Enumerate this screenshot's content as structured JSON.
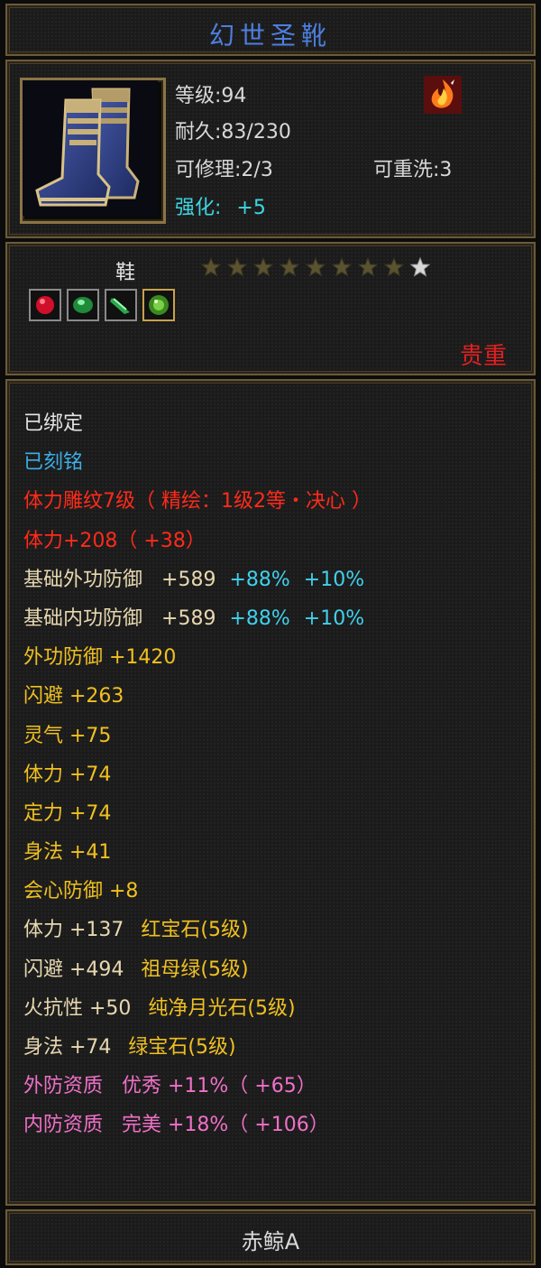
{
  "title": "幻世圣靴",
  "header": {
    "level": "等级:94",
    "durability": "耐久:83/230",
    "repairable": "可修理:2/3",
    "rewashable": "可重洗:3",
    "refine_label": "强化:",
    "refine_value": "+5"
  },
  "equip": {
    "type": "鞋",
    "stars_filled": 8,
    "stars_total": 9,
    "rarity": "贵重"
  },
  "attributes": {
    "bound": "已绑定",
    "engraved": "已刻铭",
    "carving": "体力雕纹7级（ 精绘：1级2等・决心 ）",
    "stamina_bonus": "体力+208（ +38）",
    "base_ext_def": {
      "label": "基础外功防御",
      "value": "+589",
      "pct1": "+88%",
      "pct2": "+10%"
    },
    "base_int_def": {
      "label": "基础内功防御",
      "value": "+589",
      "pct1": "+88%",
      "pct2": "+10%"
    },
    "ext_def": "外功防御 +1420",
    "dodge": "闪避 +263",
    "spirit": "灵气 +75",
    "stamina": "体力 +74",
    "focus": "定力 +74",
    "agility": "身法 +41",
    "crit_def": "会心防御 +8",
    "gem1": {
      "stat": "体力 +137",
      "gem": "红宝石(5级)"
    },
    "gem2": {
      "stat": "闪避 +494",
      "gem": "祖母绿(5级)"
    },
    "gem3": {
      "stat": "火抗性 +50",
      "gem": "纯净月光石(5级)"
    },
    "gem4": {
      "stat": "身法 +74",
      "gem": "绿宝石(5级)"
    },
    "ext_quality": "外防资质   优秀 +11%（ +65）",
    "int_quality": "内防资质   完美 +18%（ +106）"
  },
  "footer": {
    "owner": "赤鲸A"
  },
  "colors": {
    "title": "#4d7fe0",
    "refine": "#3ed6e0",
    "rarity": "#e02020",
    "gold_attr": "#f0c020",
    "pink_attr": "#f070c8"
  },
  "icons": [
    "boots-icon",
    "fire-skill-icon",
    "star-icon",
    "red-gem-icon",
    "green-gem-icon",
    "jade-gem-icon",
    "emerald-gem-icon"
  ]
}
